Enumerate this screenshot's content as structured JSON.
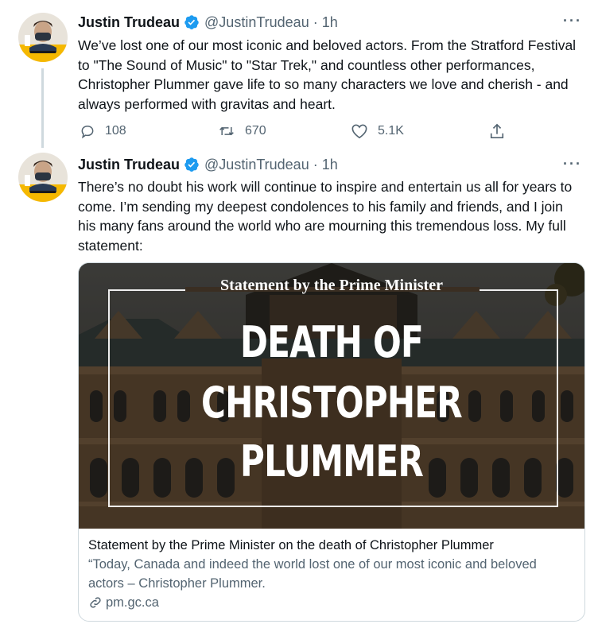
{
  "tweets": [
    {
      "author": "Justin Trudeau",
      "handle": "@JustinTrudeau",
      "separator": "·",
      "time": "1h",
      "more": "···",
      "text": "We’ve lost one of our most iconic and beloved actors. From the Stratford Festival to \"The Sound of Music\" to \"Star Trek,\" and countless other performances, Christopher Plummer gave life to so many characters we love and cherish - and always performed with gravitas and heart.",
      "replies": "108",
      "retweets": "670",
      "likes": "5.1K"
    },
    {
      "author": "Justin Trudeau",
      "handle": "@JustinTrudeau",
      "separator": "·",
      "time": "1h",
      "more": "···",
      "text": "There’s no doubt his work will continue to inspire and entertain us all for years to come. I’m sending my deepest condolences to his family and friends, and I join his many fans around the world who are mourning this tremendous loss. My full statement:"
    }
  ],
  "card": {
    "image_heading": "Statement by the Prime Minister",
    "image_headline": [
      "DEATH OF",
      "CHRISTOPHER",
      "PLUMMER"
    ],
    "title": "Statement by the Prime Minister on the death of Christopher Plummer",
    "description": "“Today, Canada and indeed the world lost one of our most iconic and beloved actors – Christopher Plummer.",
    "domain": "pm.gc.ca"
  },
  "icons": [
    "verified-badge-icon",
    "reply-icon",
    "retweet-icon",
    "like-icon",
    "share-icon",
    "link-icon",
    "more-icon"
  ],
  "colors": {
    "verified": "#1d9bf0",
    "secondary_text": "#536471",
    "avatar_accent": "#f5b800"
  }
}
